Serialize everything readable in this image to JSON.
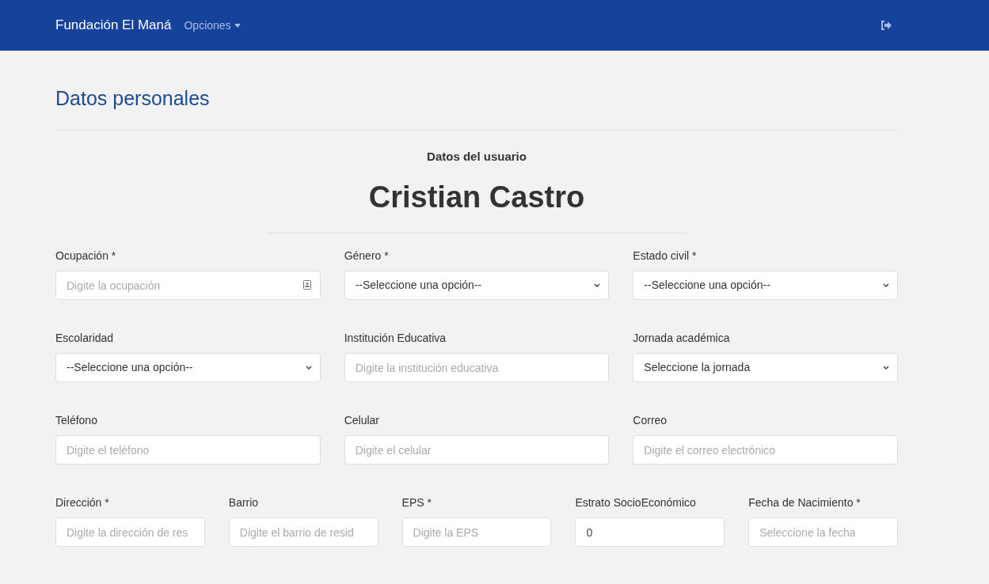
{
  "navbar": {
    "brand": "Fundación El Maná",
    "menu": "Opciones"
  },
  "page_title": "Datos personales",
  "subtitle": "Datos del usuario",
  "user_name": "Cristian Castro",
  "form_rows": [
    [
      {
        "label": "Ocupación *",
        "kind": "text-icon",
        "placeholder": "Digite la ocupación"
      },
      {
        "label": "Género *",
        "kind": "select",
        "value": "--Seleccione una opción--"
      },
      {
        "label": "Estado civil *",
        "kind": "select",
        "value": "--Seleccione una opción--"
      }
    ],
    [
      {
        "label": "Escolaridad",
        "kind": "select",
        "value": "--Seleccione una opción--"
      },
      {
        "label": "Institución Educativa",
        "kind": "text",
        "placeholder": "Digite la institución educativa"
      },
      {
        "label": "Jornada académica",
        "kind": "select",
        "value": "Seleccione la jornada"
      }
    ],
    [
      {
        "label": "Teléfono",
        "kind": "text",
        "placeholder": "Digite el teléfono"
      },
      {
        "label": "Celular",
        "kind": "text",
        "placeholder": "Digite el celular"
      },
      {
        "label": "Correo",
        "kind": "text",
        "placeholder": "Digite el correo electrónico"
      }
    ],
    [
      {
        "label": "Dirección *",
        "kind": "text",
        "placeholder": "Digite la dirección de res"
      },
      {
        "label": "Barrio",
        "kind": "text",
        "placeholder": "Digite el barrio de resid"
      },
      {
        "label": "EPS *",
        "kind": "text",
        "placeholder": "Digite la EPS"
      },
      {
        "label": "Estrato SocioEconómico",
        "kind": "text",
        "value": "0"
      },
      {
        "label": "Fecha de Nacimiento *",
        "kind": "text",
        "placeholder": "Seleccione la fecha"
      }
    ]
  ]
}
